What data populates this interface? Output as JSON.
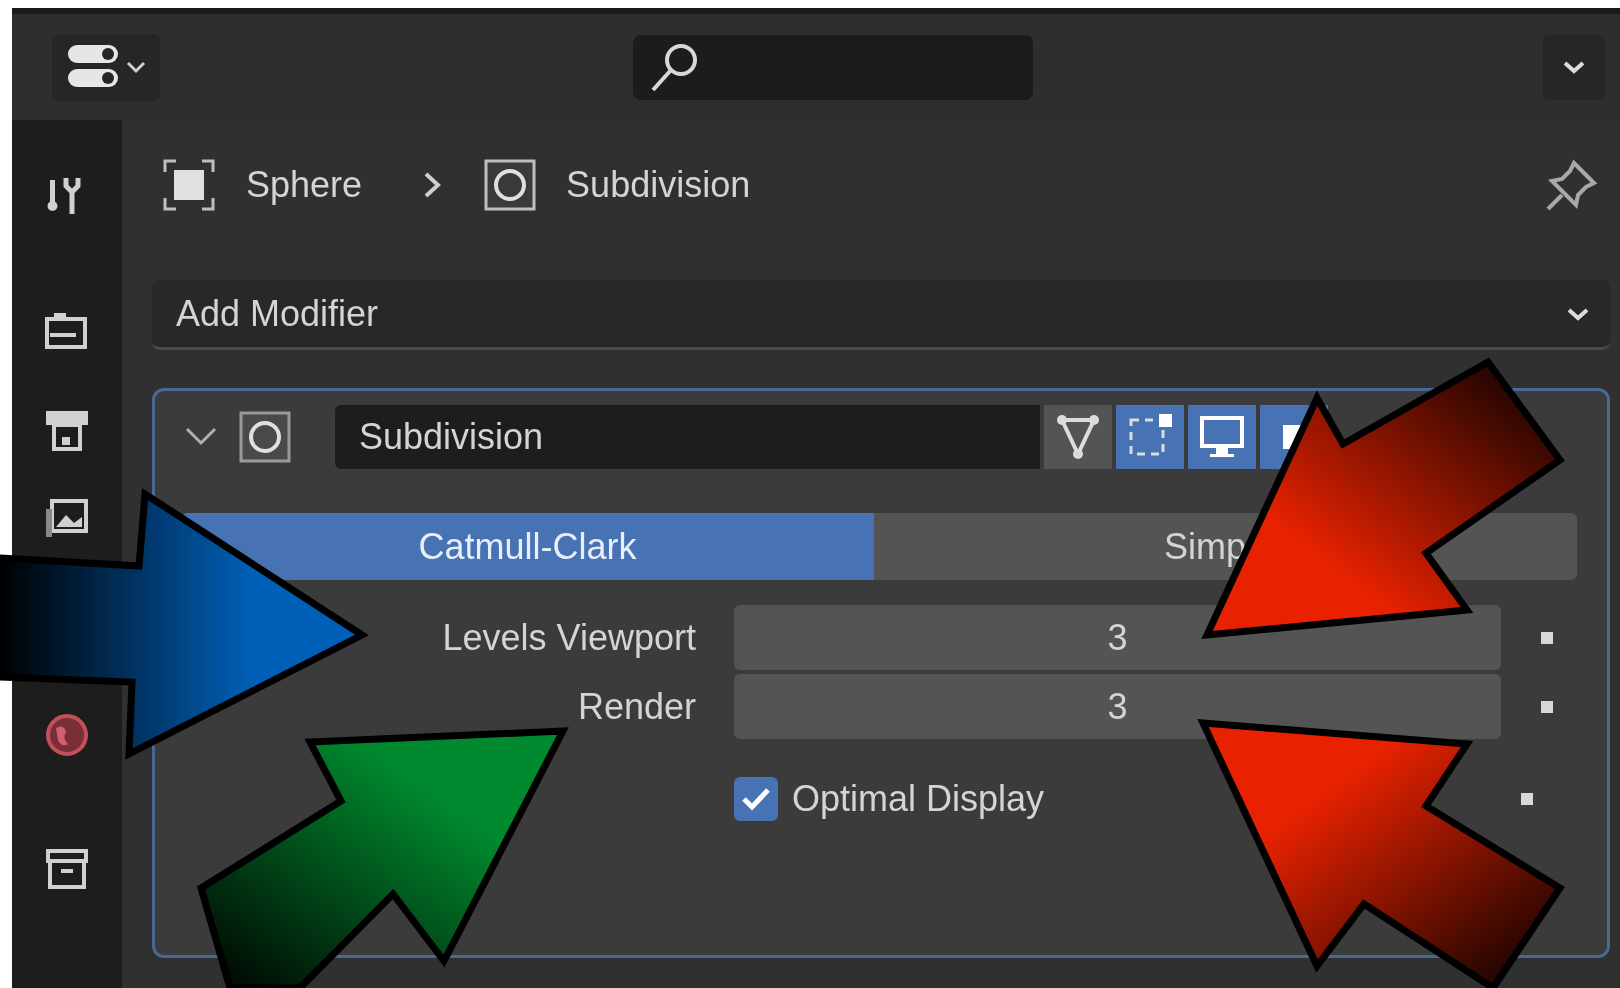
{
  "sidebar": [
    {
      "kind": "tool"
    },
    {
      "kind": "render"
    },
    {
      "kind": "output"
    },
    {
      "kind": "view_layer"
    },
    {
      "kind": "world"
    },
    {
      "kind": "collection"
    }
  ],
  "breadcrumb": [
    {
      "kind": "object",
      "label": "Sphere"
    },
    {
      "kind": "modifier",
      "label": "Subdivision"
    }
  ],
  "add_modifier": {
    "label": "Add Modifier"
  },
  "modifier": {
    "name": "Subdivision",
    "expanded": true,
    "toggles": [
      {
        "kind": "mesh",
        "on": false
      },
      {
        "kind": "vertices",
        "on": true
      },
      {
        "kind": "viewport",
        "on": true
      },
      {
        "kind": "render",
        "on": true
      }
    ],
    "subdivision_type": [
      {
        "label": "Catmull-Clark",
        "selected": true
      },
      {
        "label": "Simp",
        "selected": false
      }
    ],
    "fields": [
      {
        "label": "Levels Viewport",
        "value": "3"
      },
      {
        "label": "Render",
        "value": "3"
      }
    ],
    "optimal_display": {
      "label": "Optimal Display",
      "checked": true
    }
  },
  "annotation_arrows": [
    {
      "kind": "right",
      "color": "#0060b8"
    },
    {
      "kind": "up_right",
      "color": "#00892e"
    },
    {
      "kind": "down_left",
      "color": "#e82200"
    },
    {
      "kind": "up_left",
      "color": "#e82200"
    }
  ]
}
